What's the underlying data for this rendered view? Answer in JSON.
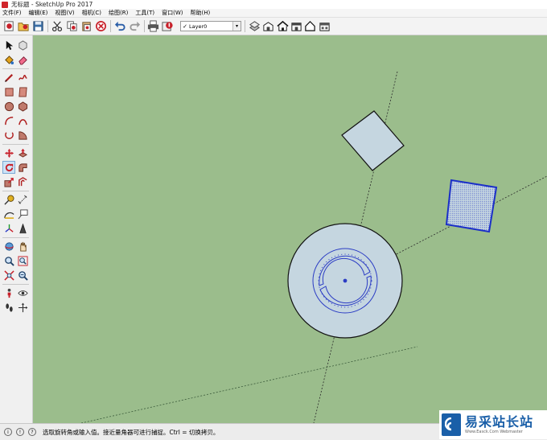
{
  "window": {
    "title": "无标题 - SketchUp Pro 2017"
  },
  "menu": [
    "文件(F)",
    "编辑(E)",
    "视图(V)",
    "相机(C)",
    "绘图(R)",
    "工具(T)",
    "窗口(W)",
    "帮助(H)"
  ],
  "toolbar": {
    "layer": {
      "check": "✓",
      "value": "Layer0"
    }
  },
  "status": {
    "message": "选取旋转角或输入值。接近量角器可进行捕捉。Ctrl = 切换拷贝。"
  },
  "watermark": {
    "main": "易采站长站",
    "sub": "Www.Easck.Com Webmaster"
  },
  "colors": {
    "viewport_bg": "#9bbd8c",
    "face_fill": "#c5d6e0",
    "selected_outline": "#1b2fc8",
    "protractor": "#2b3cc4"
  }
}
